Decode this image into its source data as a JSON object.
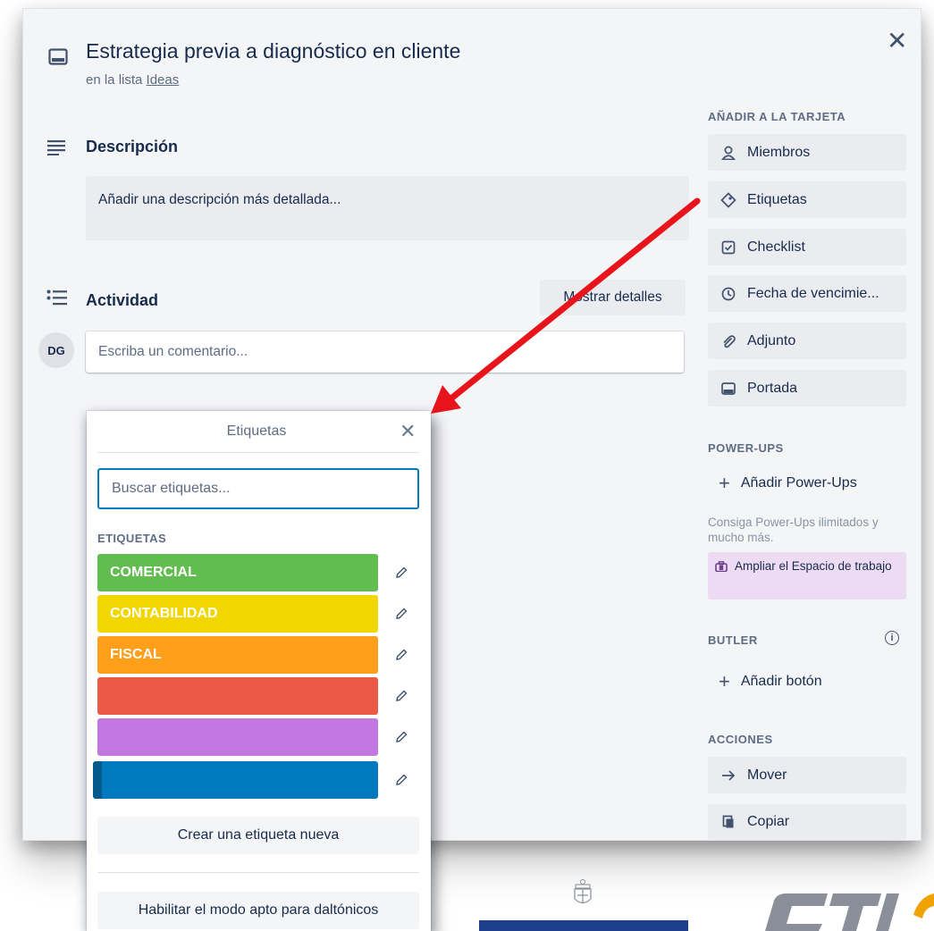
{
  "card": {
    "title": "Estrategia previa a diagnóstico en cliente",
    "list_prefix": "en la lista ",
    "list_name": "Ideas",
    "description_title": "Descripción",
    "description_placeholder": "Añadir una descripción más detallada...",
    "activity_title": "Actividad",
    "show_details": "Mostrar detalles",
    "avatar_initials": "DG",
    "comment_placeholder": "Escriba un comentario..."
  },
  "sidebar": {
    "add_heading": "AÑADIR A LA TARJETA",
    "add_items": [
      {
        "label": "Miembros",
        "icon": "person-icon"
      },
      {
        "label": "Etiquetas",
        "icon": "tag-icon"
      },
      {
        "label": "Checklist",
        "icon": "checklist-icon"
      },
      {
        "label": "Fecha de vencimie...",
        "icon": "clock-icon"
      },
      {
        "label": "Adjunto",
        "icon": "paperclip-icon"
      },
      {
        "label": "Portada",
        "icon": "cover-icon"
      }
    ],
    "powerups_heading": "POWER-UPS",
    "add_powerups": "Añadir Power-Ups",
    "promo_text": "Consiga Power-Ups ilimitados y mucho más.",
    "upgrade_label": "Ampliar el Espacio de trabajo",
    "butler_heading": "BUTLER",
    "add_button": "Añadir botón",
    "actions_heading": "ACCIONES",
    "actions": [
      {
        "label": "Mover",
        "icon": "arrow-right-icon"
      },
      {
        "label": "Copiar",
        "icon": "copy-icon"
      }
    ]
  },
  "labels_popover": {
    "title": "Etiquetas",
    "search_placeholder": "Buscar etiquetas...",
    "section_heading": "ETIQUETAS",
    "labels": [
      {
        "name": "COMERCIAL",
        "color": "#61bd4f"
      },
      {
        "name": "CONTABILIDAD",
        "color": "#f2d600"
      },
      {
        "name": "FISCAL",
        "color": "#ff9f1a"
      },
      {
        "name": "",
        "color": "#eb5a46"
      },
      {
        "name": "",
        "color": "#c377e0"
      },
      {
        "name": "",
        "color": "#0079bf"
      }
    ],
    "create_label": "Crear una etiqueta nueva",
    "colorblind_mode": "Habilitar el modo apto para daltónicos"
  },
  "colors": {
    "accent_blue": "#0079bf",
    "annotation_arrow": "#e8141b",
    "upgrade_bg": "#eddbf4"
  }
}
